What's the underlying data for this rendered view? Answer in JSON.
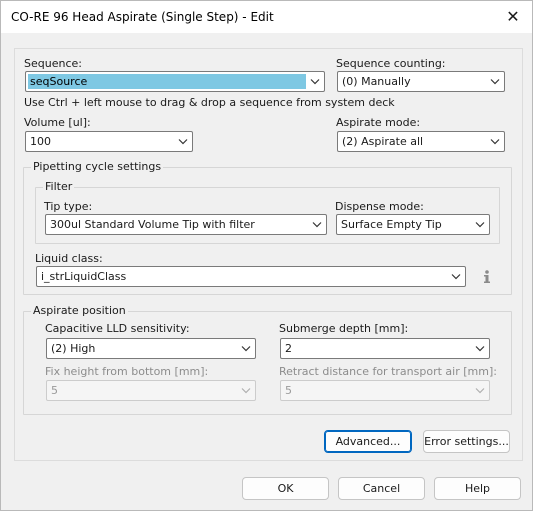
{
  "window": {
    "title": "CO-RE 96 Head Aspirate (Single Step) - Edit",
    "close_glyph": "✕"
  },
  "sequence": {
    "label": "Sequence:",
    "value": "seqSource",
    "hint": "Use Ctrl + left mouse to drag & drop a sequence from system deck"
  },
  "sequence_counting": {
    "label": "Sequence counting:",
    "value": "(0) Manually"
  },
  "volume": {
    "label": "Volume [ul]:",
    "value": "100"
  },
  "aspirate_mode": {
    "label": "Aspirate mode:",
    "value": "(2) Aspirate all"
  },
  "pipetting": {
    "group_title": "Pipetting cycle settings",
    "filter_title": "Filter",
    "tip_type_label": "Tip type:",
    "tip_type_value": "300ul Standard Volume Tip with filter",
    "dispense_mode_label": "Dispense mode:",
    "dispense_mode_value": "Surface Empty Tip",
    "liquid_class_label": "Liquid class:",
    "liquid_class_value": "i_strLiquidClass",
    "info_icon": "info-icon"
  },
  "aspirate_position": {
    "group_title": "Aspirate position",
    "lld_label": "Capacitive LLD sensitivity:",
    "lld_value": "(2) High",
    "submerge_label": "Submerge depth [mm]:",
    "submerge_value": "2",
    "fix_height_label": "Fix height from bottom [mm]:",
    "fix_height_value": "5",
    "retract_label": "Retract distance for transport air [mm]:",
    "retract_value": "5"
  },
  "buttons": {
    "advanced": "Advanced...",
    "error_settings": "Error settings...",
    "ok": "OK",
    "cancel": "Cancel",
    "help": "Help"
  },
  "colors": {
    "accent": "#0067c0",
    "selection": "#7ec8e3"
  }
}
